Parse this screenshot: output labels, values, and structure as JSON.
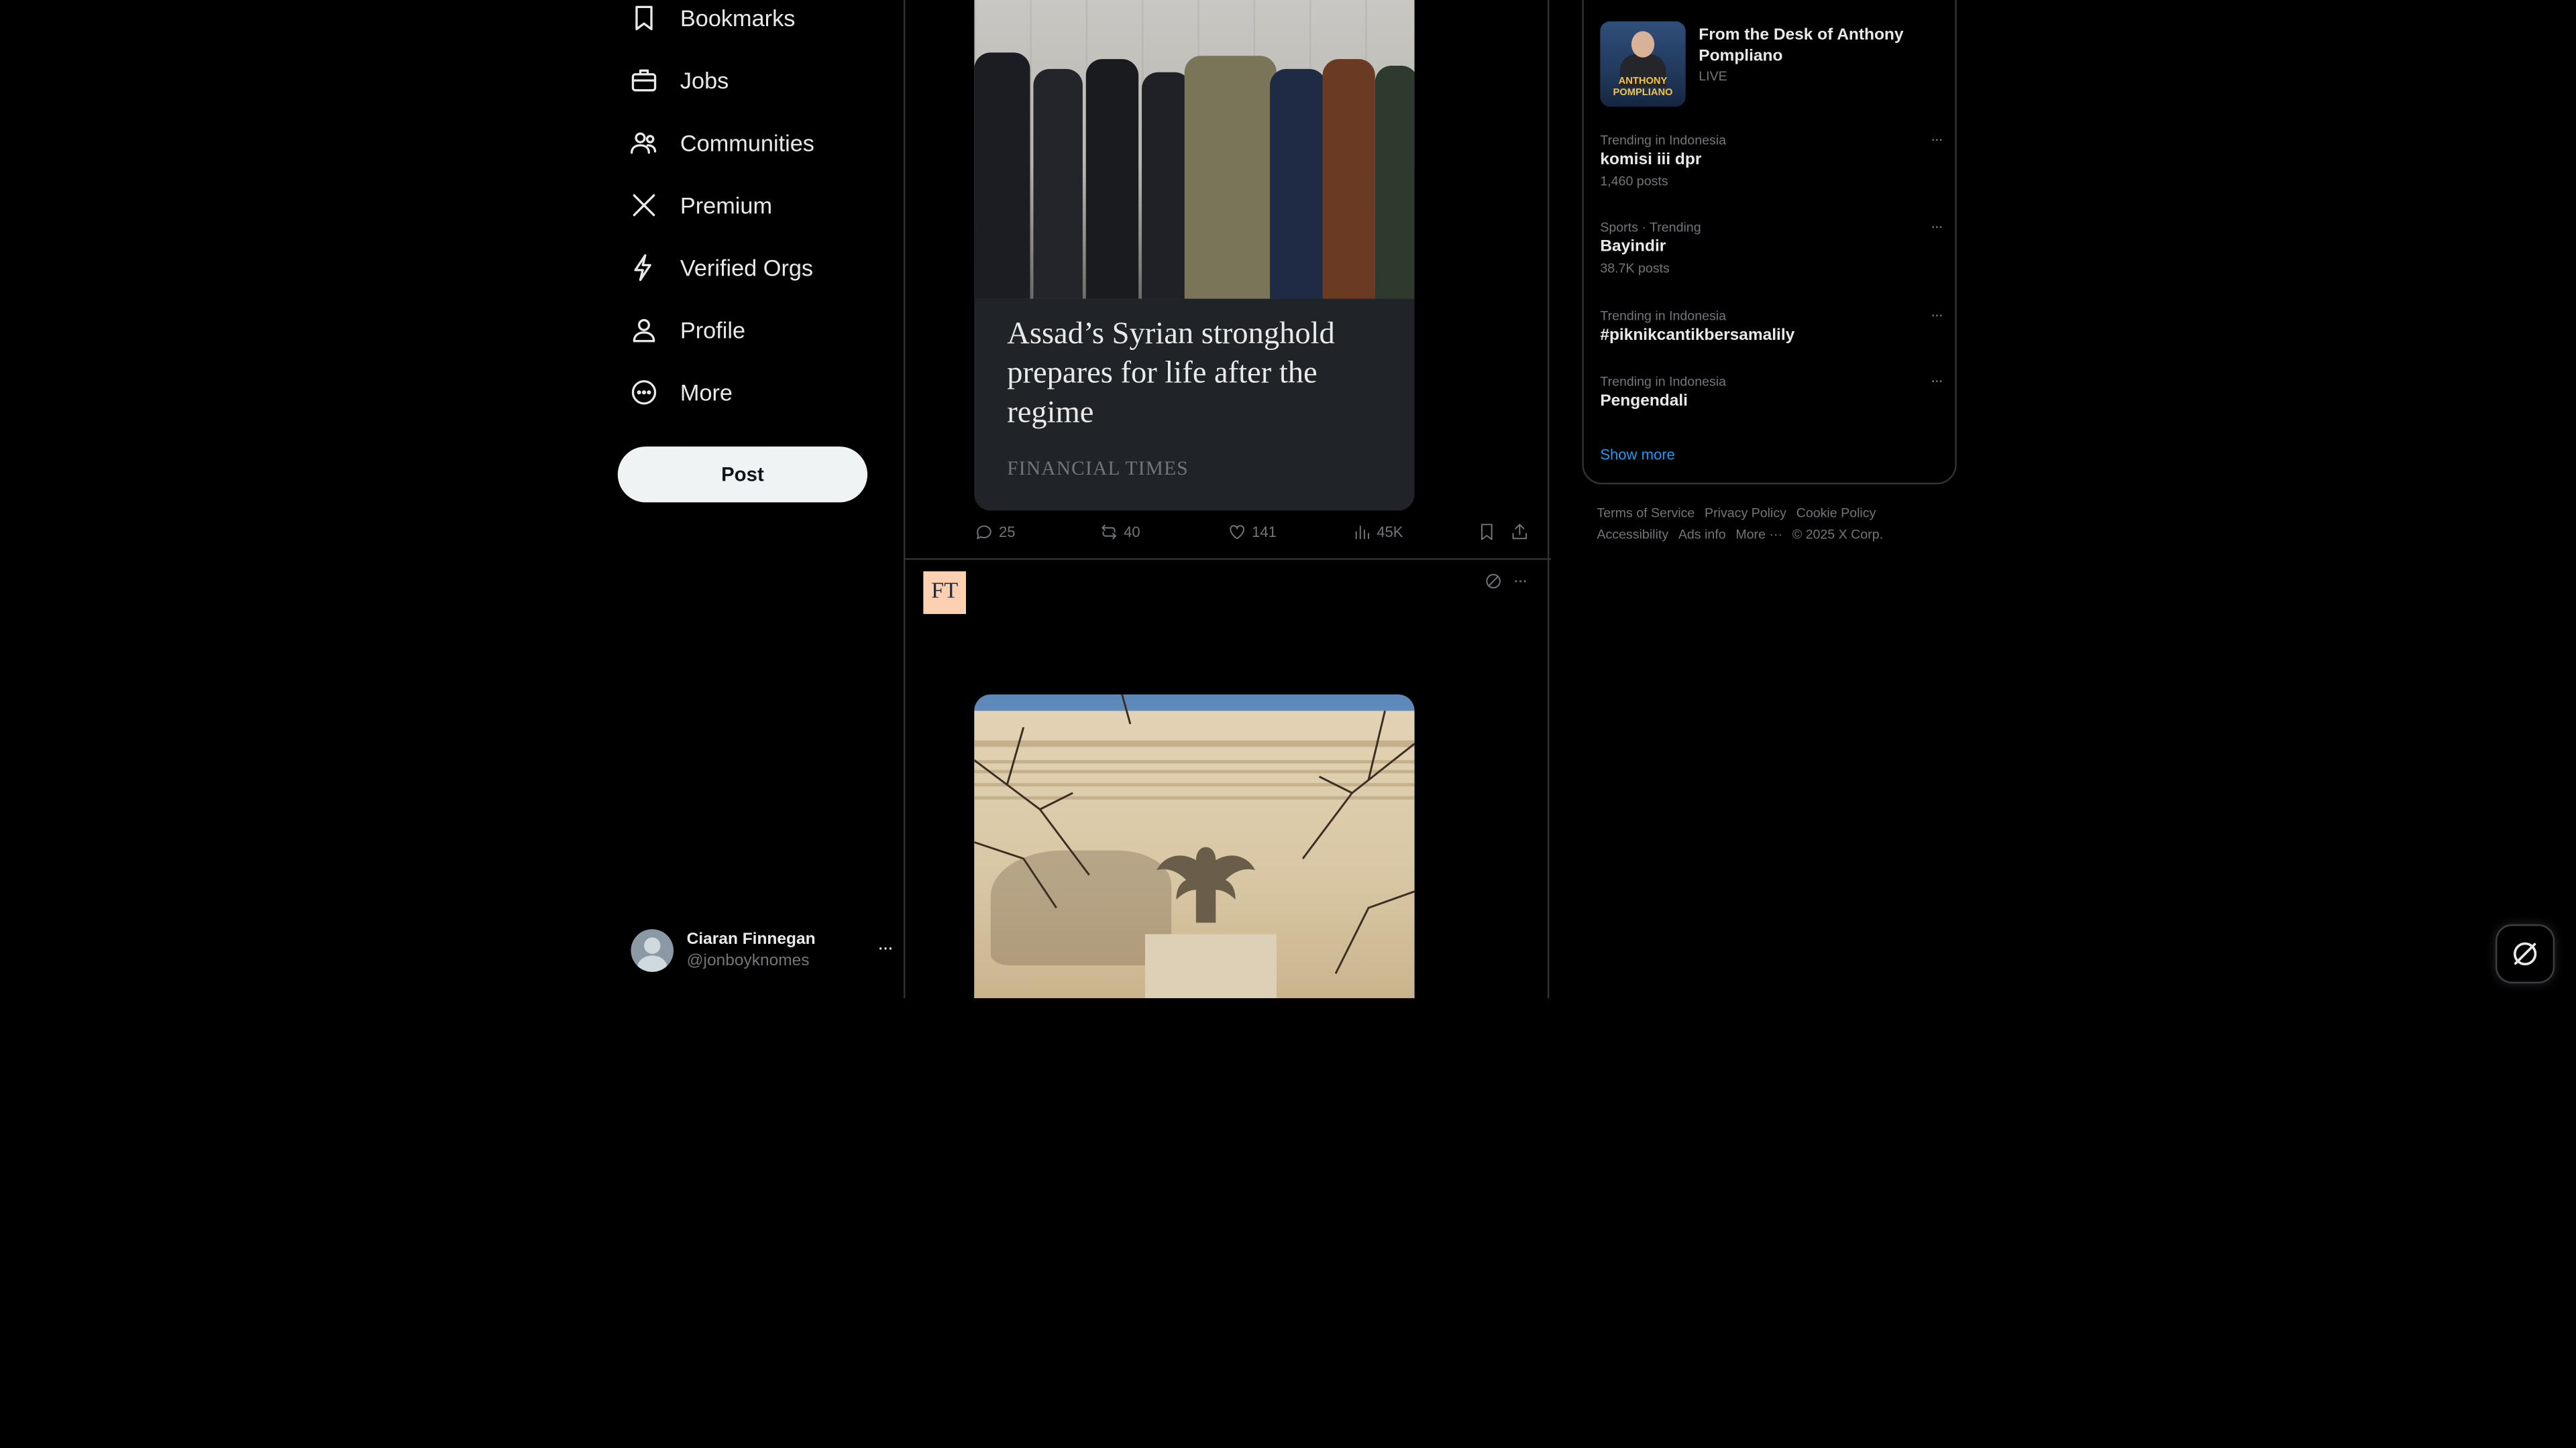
{
  "nav": {
    "items": [
      {
        "label": "Bookmarks",
        "icon": "bookmark-icon"
      },
      {
        "label": "Jobs",
        "icon": "briefcase-icon"
      },
      {
        "label": "Communities",
        "icon": "communities-icon"
      },
      {
        "label": "Premium",
        "icon": "x-logo-icon"
      },
      {
        "label": "Verified Orgs",
        "icon": "lightning-icon"
      },
      {
        "label": "Profile",
        "icon": "person-icon"
      },
      {
        "label": "More",
        "icon": "more-circle-icon"
      }
    ],
    "post_label": "Post"
  },
  "account": {
    "name": "Ciaran Finnegan",
    "handle": "@jonboyknomes",
    "more": "···"
  },
  "feed": {
    "post1": {
      "card_title": "Assad’s Syrian stronghold prepares for life after the regime",
      "card_source": "FINANCIAL TIMES",
      "replies": "25",
      "reposts": "40",
      "likes": "141",
      "views": "45K"
    },
    "post2": {
      "avatar_text": "FT",
      "more": "···"
    }
  },
  "sidebar": {
    "live": {
      "title": "From the Desk of Anthony Pompliano",
      "status": "LIVE",
      "thumb_line1": "ANTHONY",
      "thumb_line2": "POMPLIANO"
    },
    "trends": [
      {
        "context": "Trending in Indonesia",
        "title": "komisi iii dpr",
        "count": "1,460 posts"
      },
      {
        "context": "Sports · Trending",
        "title": "Bayindir",
        "count": "38.7K posts"
      },
      {
        "context": "Trending in Indonesia",
        "title": "#piknikcantikbersamalily",
        "count": ""
      },
      {
        "context": "Trending in Indonesia",
        "title": "Pengendali",
        "count": ""
      }
    ],
    "trend_more": "···",
    "show_more": "Show more"
  },
  "footer": {
    "links": [
      "Terms of Service",
      "Privacy Policy",
      "Cookie Policy",
      "Accessibility",
      "Ads info",
      "More ···"
    ],
    "copyright": "© 2025 X Corp."
  },
  "colors": {
    "background": "#000000",
    "text": "#e7e9ea",
    "muted": "#71767b",
    "border": "#2f3336",
    "accent": "#1d9bf0",
    "ft_pink": "#fcd0b1"
  }
}
